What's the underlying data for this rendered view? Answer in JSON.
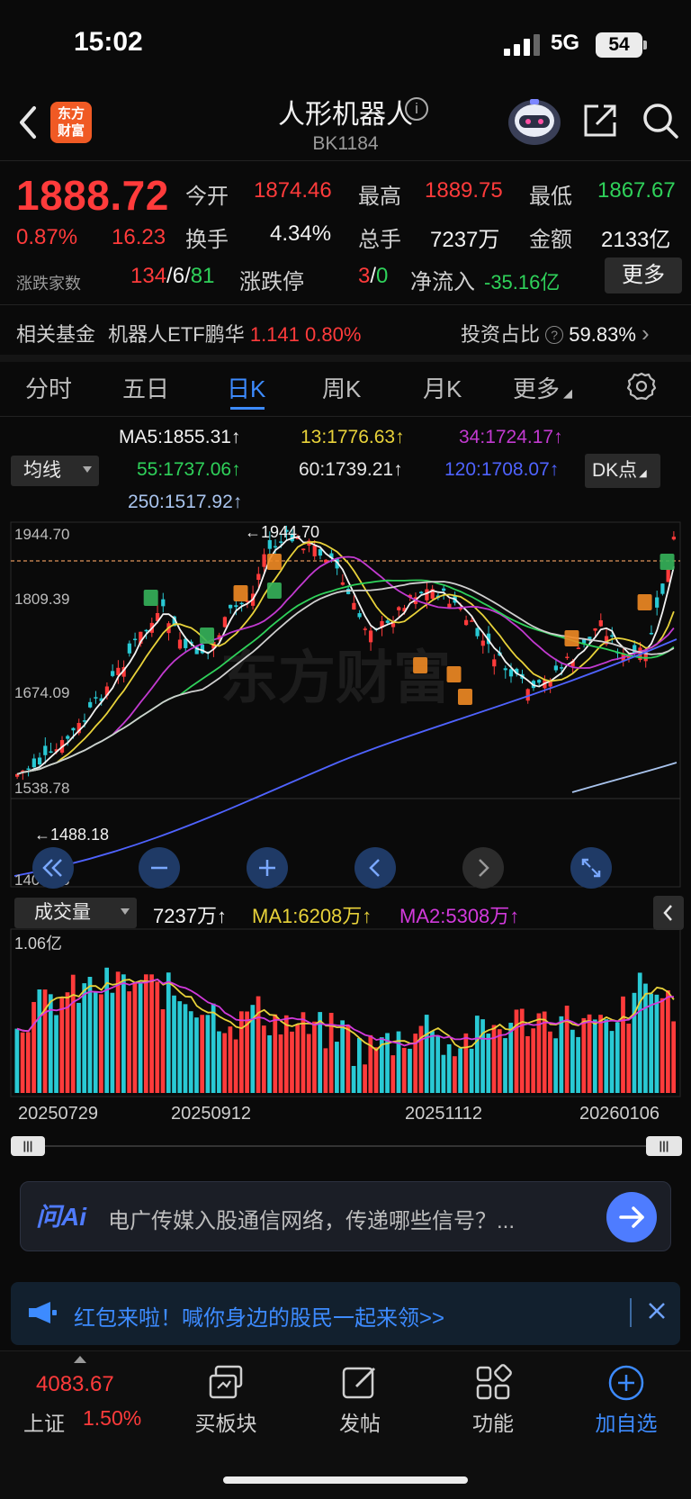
{
  "status_bar": {
    "time": "15:02",
    "network": "5G",
    "battery": "54"
  },
  "header": {
    "logo_text_1": "东方",
    "logo_text_2": "财富",
    "title": "人形机器人",
    "info": "i",
    "code": "BK1184"
  },
  "quote": {
    "price": "1888.72",
    "change_pct": "0.87%",
    "change_abs": "16.23",
    "fields": [
      {
        "label": "今开",
        "value": "1874.46",
        "color": "#ff3b3b"
      },
      {
        "label": "最高",
        "value": "1889.75",
        "color": "#ff3b3b"
      },
      {
        "label": "最低",
        "value": "1867.67",
        "color": "#2fd15a"
      },
      {
        "label": "换手",
        "value": "4.34%",
        "color": "#f2f2f2"
      },
      {
        "label": "总手",
        "value": "7237万",
        "color": "#f2f2f2"
      },
      {
        "label": "金额",
        "value": "2133亿",
        "color": "#f2f2f2"
      }
    ],
    "breadth_label": "涨跌家数",
    "breadth_up": "134",
    "breadth_sep1": "/",
    "breadth_flat": "6",
    "breadth_sep2": "/",
    "breadth_down": "81",
    "limit_label": "涨跌停",
    "limit_up": "3",
    "limit_sep": "/",
    "limit_down": "0",
    "netflow_label": "净流入",
    "netflow_value": "-35.16亿",
    "more_label": "更多"
  },
  "fund": {
    "label": "相关基金",
    "name": "机器人ETF鹏华",
    "price": "1.141",
    "pct": "0.80%",
    "ratio_label": "投资占比",
    "help": "?",
    "ratio_value": "59.83%",
    "arrow": "›"
  },
  "tabs": [
    {
      "label": "分时",
      "active": false
    },
    {
      "label": "五日",
      "active": false
    },
    {
      "label": "日K",
      "active": true
    },
    {
      "label": "周K",
      "active": false
    },
    {
      "label": "月K",
      "active": false
    },
    {
      "label": "更多",
      "active": false
    }
  ],
  "ma_legend": {
    "dropdown": "均线",
    "dk_button": "DK点",
    "items": [
      {
        "text": "MA5:1855.31↑",
        "color": "#f2f2f2"
      },
      {
        "text": "13:1776.63↑",
        "color": "#e8d23a"
      },
      {
        "text": "34:1724.17↑",
        "color": "#c23ad0"
      },
      {
        "text": "55:1737.06↑",
        "color": "#2fd15a"
      },
      {
        "text": "60:1739.21↑",
        "color": "#e6e6e6"
      },
      {
        "text": "120:1708.07↑",
        "color": "#4f63ff"
      },
      {
        "text": "250:1517.92↑",
        "color": "#a9c4ee"
      }
    ]
  },
  "price_axis": {
    "labels": [
      "1944.70",
      "1809.39",
      "1674.09",
      "1538.78",
      "1403.48"
    ],
    "max_marker": "←1944.70",
    "min_marker": "←1488.18"
  },
  "volume": {
    "dropdown": "成交量",
    "current": "7237万↑",
    "ma1": "MA1:6208万↑",
    "ma2": "MA2:5308万↑",
    "axis_max": "1.06亿",
    "dates": [
      "20250729",
      "20250912",
      "20251112",
      "20260106"
    ]
  },
  "scroll_handles": {
    "left": "|||",
    "right": "|||"
  },
  "ai_bar": {
    "logo": "问Ai",
    "prompt": "电广传媒入股通信网络，传递哪些信号？..."
  },
  "notice": {
    "text": "红包来啦！喊你身边的股民一起来领>>"
  },
  "bottom_nav": {
    "index_name": "上证",
    "index_value": "4083.67",
    "index_pct": "1.50%",
    "items": [
      "买板块",
      "发帖",
      "功能",
      "加自选"
    ]
  },
  "colors": {
    "up": "#ff3b3b",
    "down": "#2fd15a",
    "accent": "#3d8bff",
    "candle_down": "#29c9d4"
  }
}
